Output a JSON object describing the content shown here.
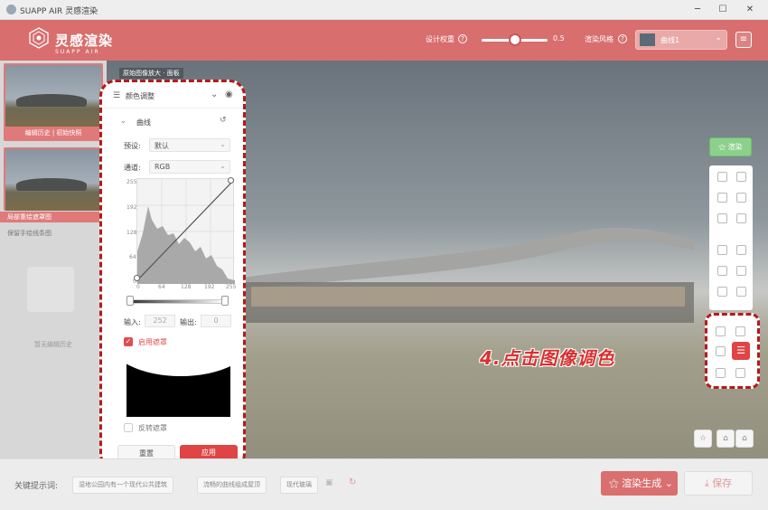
{
  "window": {
    "title": "SUAPP AIR 灵感渲染",
    "minimize": "─",
    "maximize": "☐",
    "close": "✕"
  },
  "header": {
    "brand": "灵感渲染",
    "brand_sub": "SUAPP AIR",
    "weight_label": "设计权重",
    "weight_value": "0.5",
    "render_style_label": "渲染风格",
    "render_style_value": "曲线1",
    "menu_icon": "menu-icon"
  },
  "left_panel": {
    "history_caption": "编辑历史 | 初始快照",
    "selected_item": "局部重绘遮罩图",
    "sub_item": "保留手绘线条图",
    "empty_text": "暂无编辑历史"
  },
  "canvas": {
    "tag": "原始图像放大 · 面板"
  },
  "adjust_panel": {
    "title": "颜色调整",
    "section": "曲线",
    "preset_label": "预设:",
    "preset_value": "默认",
    "channel_label": "通道:",
    "channel_value": "RGB",
    "y_ticks": [
      "255",
      "192",
      "128",
      "64",
      "0"
    ],
    "x_ticks": [
      "0",
      "64",
      "128",
      "192",
      "255"
    ],
    "input_label": "输入:",
    "input_value": "252",
    "output_label": "输出:",
    "output_value": "0",
    "use_mask_label": "启用遮罩",
    "invert_mask_label": "反转遮罩",
    "reset_label": "重置",
    "apply_label": "应用"
  },
  "tools": {
    "render_label": "渲染",
    "callout": "4.点击图像调色"
  },
  "bottom": {
    "keyword_label": "关键提示词:",
    "chips": [
      "湿地公园内有一个现代公共建筑",
      "流畅的曲线组成屋顶",
      "现代玻璃"
    ],
    "generate_label": "渲染生成",
    "save_label": "保存"
  },
  "colors": {
    "accent": "#d86e6e",
    "highlight": "#b31b1b",
    "render_green": "#8bd08b",
    "callout_red": "#d93131"
  }
}
